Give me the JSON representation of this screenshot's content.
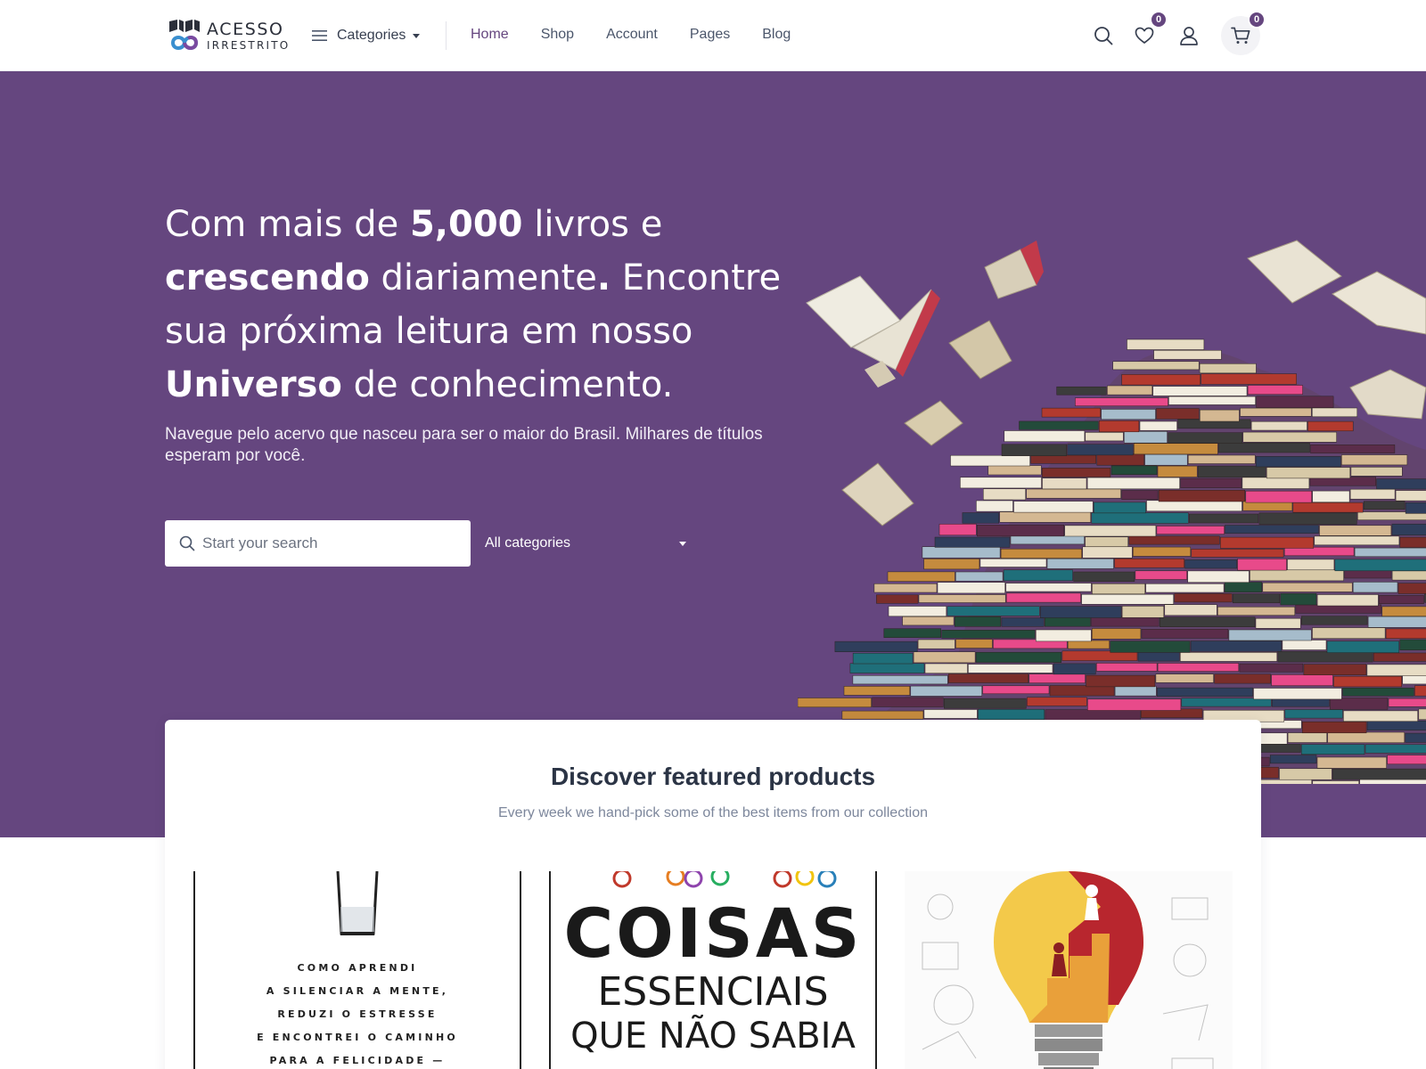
{
  "brand": {
    "line1": "ACESSO",
    "line2": "IRRESTRITO"
  },
  "header": {
    "categories_label": "Categories",
    "nav": [
      "Home",
      "Shop",
      "Account",
      "Pages",
      "Blog"
    ],
    "wishlist_count": "0",
    "cart_count": "0"
  },
  "hero": {
    "title_parts": [
      "Com mais de ",
      "5,000",
      " livros e ",
      "crescendo",
      " diariamente",
      ".",
      " Encontre sua próxima leitura em nosso ",
      "Universo",
      " de conhecimento."
    ],
    "subtitle": "Navegue pelo acervo que nasceu para ser o maior do Brasil. Milhares de títulos esperam por você.",
    "search_placeholder": "Start your search",
    "category_select": "All categories"
  },
  "featured": {
    "title": "Discover featured products",
    "subtitle": "Every week we hand-pick some of the best items from our collection",
    "products": [
      {
        "cover_lines": [
          "COMO APRENDI",
          "A SILENCIAR A MENTE,",
          "REDUZI O ESTRESSE",
          "E ENCONTREI O CAMINHO",
          "PARA A FELICIDADE —"
        ]
      },
      {
        "cover_lines": [
          "COISAS",
          "ESSENCIAIS",
          "QUE NÃO SABIA"
        ]
      },
      {
        "cover_lines": []
      }
    ]
  },
  "colors": {
    "brand_purple": "#65467f",
    "text_dark": "#2b3445",
    "muted": "#7d879c"
  }
}
